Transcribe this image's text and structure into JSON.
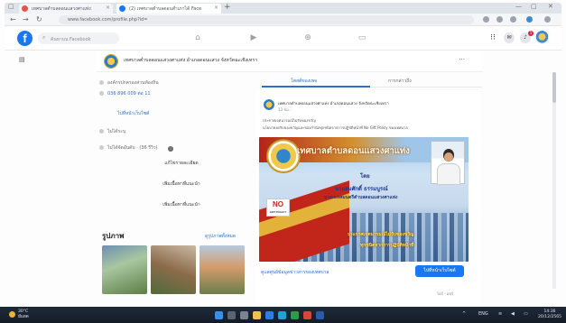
{
  "browser": {
    "tabs": [
      {
        "label": "เทศบาลตำบลดอนแสวงศาแท่ง",
        "color": "#e2554a"
      },
      {
        "label": "(2) เทศบาลตำบลดอนสำเภาได้ Face",
        "color": "#1877f2"
      }
    ],
    "url": "www.facebook.com/profile.php?id=",
    "new_tab": "+"
  },
  "facebook": {
    "logo": "f",
    "search_placeholder": "ค้นหาบน Facebook",
    "notification_count": "1"
  },
  "page": {
    "name": "เทศบาลตำบลดอนแสวงศาแท่ง อำเภอดอนแสวง จังหวัดฉะเชิงเทรา",
    "more": "···"
  },
  "intro": {
    "rows": [
      "องค์กรปกครองส่วนท้องถิ่น",
      "036 896 009 ต่อ 11",
      "ไม่ได้ระบุ"
    ],
    "website_link": "ไปที่หน้าเว็บไซต์",
    "rating_label": "ไม่ได้จัดอันดับ · (36 รีวิว)",
    "rec_badge": "i",
    "pills": [
      "แก้ไขรายละเอียด",
      "เพิ่มเนื้อหาที่แนะนำ",
      "เพิ่มเนื้อหาที่แนะนำ"
    ]
  },
  "photos": {
    "title": "รูปภาพ",
    "see_all": "ดูรูปภาพทั้งหมด"
  },
  "feed": {
    "tabs": [
      "โพสต์ของเพจ",
      "การกล่าวถึง"
    ],
    "post_author": "เทศบาลตำบลดอนแสวงศาแท่ง อำเภอดอนแสวง จังหวัดฉะเชิงเทรา",
    "post_meta": "13 ชม. · ",
    "post_lines": [
      "ประกาศเจตนารมณ์ไม่รับของขวัญ",
      "นโยบายงดรับของขวัญและของกำนัลทุกชนิดจากการปฏิบัติหน้าที่ No Gift Policy ของเทศบาล"
    ],
    "banner": {
      "title": "เทศบาลตำบลดอนแสวงศาแท่ง",
      "by": "โดย",
      "name": "นายสมศักดิ์  ธรรมบูรณ์",
      "role": "นายกเทศมนตรีตำบลดอนแสวงศาแท่ง",
      "slogan1": "ประกาศเจตนารมณ์ไม่รับของขวัญ",
      "slogan2": "ทุกชนิดจากการปฏิบัติหน้าที่",
      "no_gift": "NO",
      "no_gift_sub": "GIFT POLICY"
    },
    "footer_link": "ดูแลศูนย์ข้อมูลข่าวสารของเทศบาล",
    "cta_button": "ไปที่หน้าเว็บไซต์",
    "footer_small": "ไลก์ · แชร์"
  },
  "taskbar": {
    "weather_temp": "30°C",
    "weather_desc": "มีแดด",
    "clock_time": "14:36",
    "clock_date": "20/12/2565",
    "tray_lang": "ENG"
  }
}
